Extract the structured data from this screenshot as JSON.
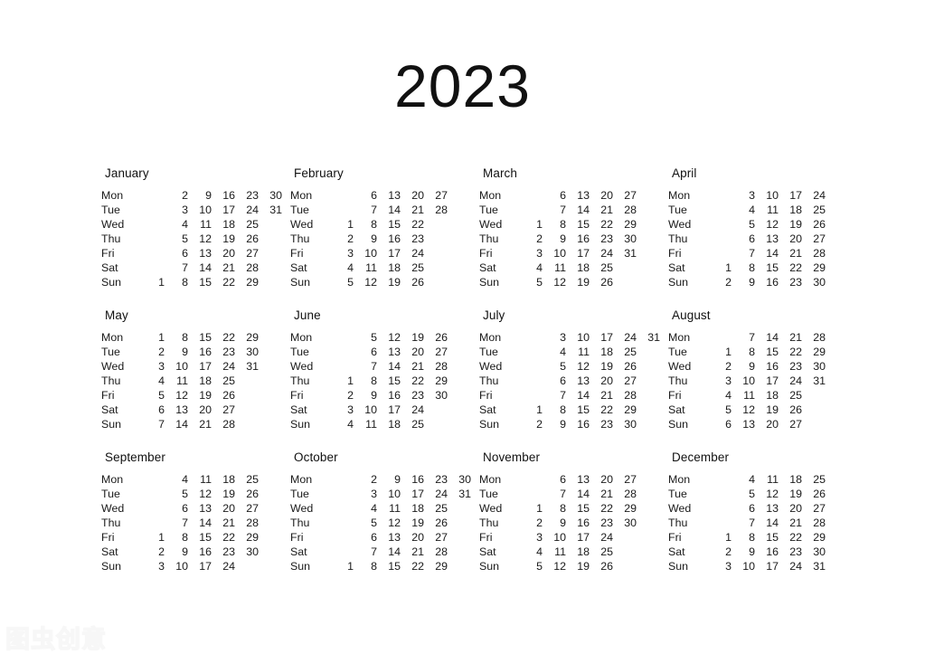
{
  "page": {
    "title": "2023",
    "background_color": "#ffffff",
    "text_color": "#1a1a1a"
  },
  "watermark": {
    "text": "图虫创意",
    "color": "#f7f7f7"
  },
  "weekday_labels": [
    "Mon",
    "Tue",
    "Wed",
    "Thu",
    "Fri",
    "Sat",
    "Sun"
  ],
  "calendar_data": {
    "year": 2023,
    "week_start": "Mon",
    "layout": {
      "columns": 4,
      "rows": 3
    },
    "months": [
      {
        "name": "January",
        "index": 1,
        "days_in_month": 31,
        "first_weekday": "Sun",
        "weeks": [
          [
            "",
            "2",
            "9",
            "16",
            "23",
            "30"
          ],
          [
            "",
            "3",
            "10",
            "17",
            "24",
            "31"
          ],
          [
            "",
            "4",
            "11",
            "18",
            "25",
            ""
          ],
          [
            "",
            "5",
            "12",
            "19",
            "26",
            ""
          ],
          [
            "",
            "6",
            "13",
            "20",
            "27",
            ""
          ],
          [
            "",
            "7",
            "14",
            "21",
            "28",
            ""
          ],
          [
            "1",
            "8",
            "15",
            "22",
            "29",
            ""
          ]
        ]
      },
      {
        "name": "February",
        "index": 2,
        "days_in_month": 28,
        "first_weekday": "Wed",
        "weeks": [
          [
            "",
            "6",
            "13",
            "20",
            "27",
            ""
          ],
          [
            "",
            "7",
            "14",
            "21",
            "28",
            ""
          ],
          [
            "1",
            "8",
            "15",
            "22",
            "",
            ""
          ],
          [
            "2",
            "9",
            "16",
            "23",
            "",
            ""
          ],
          [
            "3",
            "10",
            "17",
            "24",
            "",
            ""
          ],
          [
            "4",
            "11",
            "18",
            "25",
            "",
            ""
          ],
          [
            "5",
            "12",
            "19",
            "26",
            "",
            ""
          ]
        ]
      },
      {
        "name": "March",
        "index": 3,
        "days_in_month": 31,
        "first_weekday": "Wed",
        "weeks": [
          [
            "",
            "6",
            "13",
            "20",
            "27",
            ""
          ],
          [
            "",
            "7",
            "14",
            "21",
            "28",
            ""
          ],
          [
            "1",
            "8",
            "15",
            "22",
            "29",
            ""
          ],
          [
            "2",
            "9",
            "16",
            "23",
            "30",
            ""
          ],
          [
            "3",
            "10",
            "17",
            "24",
            "31",
            ""
          ],
          [
            "4",
            "11",
            "18",
            "25",
            "",
            ""
          ],
          [
            "5",
            "12",
            "19",
            "26",
            "",
            ""
          ]
        ]
      },
      {
        "name": "April",
        "index": 4,
        "days_in_month": 30,
        "first_weekday": "Sat",
        "weeks": [
          [
            "",
            "3",
            "10",
            "17",
            "24",
            ""
          ],
          [
            "",
            "4",
            "11",
            "18",
            "25",
            ""
          ],
          [
            "",
            "5",
            "12",
            "19",
            "26",
            ""
          ],
          [
            "",
            "6",
            "13",
            "20",
            "27",
            ""
          ],
          [
            "",
            "7",
            "14",
            "21",
            "28",
            ""
          ],
          [
            "1",
            "8",
            "15",
            "22",
            "29",
            ""
          ],
          [
            "2",
            "9",
            "16",
            "23",
            "30",
            ""
          ]
        ]
      },
      {
        "name": "May",
        "index": 5,
        "days_in_month": 31,
        "first_weekday": "Mon",
        "weeks": [
          [
            "1",
            "8",
            "15",
            "22",
            "29",
            ""
          ],
          [
            "2",
            "9",
            "16",
            "23",
            "30",
            ""
          ],
          [
            "3",
            "10",
            "17",
            "24",
            "31",
            ""
          ],
          [
            "4",
            "11",
            "18",
            "25",
            "",
            ""
          ],
          [
            "5",
            "12",
            "19",
            "26",
            "",
            ""
          ],
          [
            "6",
            "13",
            "20",
            "27",
            "",
            ""
          ],
          [
            "7",
            "14",
            "21",
            "28",
            "",
            ""
          ]
        ]
      },
      {
        "name": "June",
        "index": 6,
        "days_in_month": 30,
        "first_weekday": "Thu",
        "weeks": [
          [
            "",
            "5",
            "12",
            "19",
            "26",
            ""
          ],
          [
            "",
            "6",
            "13",
            "20",
            "27",
            ""
          ],
          [
            "",
            "7",
            "14",
            "21",
            "28",
            ""
          ],
          [
            "1",
            "8",
            "15",
            "22",
            "29",
            ""
          ],
          [
            "2",
            "9",
            "16",
            "23",
            "30",
            ""
          ],
          [
            "3",
            "10",
            "17",
            "24",
            "",
            ""
          ],
          [
            "4",
            "11",
            "18",
            "25",
            "",
            ""
          ]
        ]
      },
      {
        "name": "July",
        "index": 7,
        "days_in_month": 31,
        "first_weekday": "Sat",
        "weeks": [
          [
            "",
            "3",
            "10",
            "17",
            "24",
            "31"
          ],
          [
            "",
            "4",
            "11",
            "18",
            "25",
            ""
          ],
          [
            "",
            "5",
            "12",
            "19",
            "26",
            ""
          ],
          [
            "",
            "6",
            "13",
            "20",
            "27",
            ""
          ],
          [
            "",
            "7",
            "14",
            "21",
            "28",
            ""
          ],
          [
            "1",
            "8",
            "15",
            "22",
            "29",
            ""
          ],
          [
            "2",
            "9",
            "16",
            "23",
            "30",
            ""
          ]
        ]
      },
      {
        "name": "August",
        "index": 8,
        "days_in_month": 31,
        "first_weekday": "Tue",
        "weeks": [
          [
            "",
            "7",
            "14",
            "21",
            "28",
            ""
          ],
          [
            "1",
            "8",
            "15",
            "22",
            "29",
            ""
          ],
          [
            "2",
            "9",
            "16",
            "23",
            "30",
            ""
          ],
          [
            "3",
            "10",
            "17",
            "24",
            "31",
            ""
          ],
          [
            "4",
            "11",
            "18",
            "25",
            "",
            ""
          ],
          [
            "5",
            "12",
            "19",
            "26",
            "",
            ""
          ],
          [
            "6",
            "13",
            "20",
            "27",
            "",
            ""
          ]
        ]
      },
      {
        "name": "September",
        "index": 9,
        "days_in_month": 30,
        "first_weekday": "Fri",
        "weeks": [
          [
            "",
            "4",
            "11",
            "18",
            "25",
            ""
          ],
          [
            "",
            "5",
            "12",
            "19",
            "26",
            ""
          ],
          [
            "",
            "6",
            "13",
            "20",
            "27",
            ""
          ],
          [
            "",
            "7",
            "14",
            "21",
            "28",
            ""
          ],
          [
            "1",
            "8",
            "15",
            "22",
            "29",
            ""
          ],
          [
            "2",
            "9",
            "16",
            "23",
            "30",
            ""
          ],
          [
            "3",
            "10",
            "17",
            "24",
            "",
            ""
          ]
        ]
      },
      {
        "name": "October",
        "index": 10,
        "days_in_month": 31,
        "first_weekday": "Sun",
        "weeks": [
          [
            "",
            "2",
            "9",
            "16",
            "23",
            "30"
          ],
          [
            "",
            "3",
            "10",
            "17",
            "24",
            "31"
          ],
          [
            "",
            "4",
            "11",
            "18",
            "25",
            ""
          ],
          [
            "",
            "5",
            "12",
            "19",
            "26",
            ""
          ],
          [
            "",
            "6",
            "13",
            "20",
            "27",
            ""
          ],
          [
            "",
            "7",
            "14",
            "21",
            "28",
            ""
          ],
          [
            "1",
            "8",
            "15",
            "22",
            "29",
            ""
          ]
        ]
      },
      {
        "name": "November",
        "index": 11,
        "days_in_month": 30,
        "first_weekday": "Wed",
        "weeks": [
          [
            "",
            "6",
            "13",
            "20",
            "27",
            ""
          ],
          [
            "",
            "7",
            "14",
            "21",
            "28",
            ""
          ],
          [
            "1",
            "8",
            "15",
            "22",
            "29",
            ""
          ],
          [
            "2",
            "9",
            "16",
            "23",
            "30",
            ""
          ],
          [
            "3",
            "10",
            "17",
            "24",
            "",
            ""
          ],
          [
            "4",
            "11",
            "18",
            "25",
            "",
            ""
          ],
          [
            "5",
            "12",
            "19",
            "26",
            "",
            ""
          ]
        ]
      },
      {
        "name": "December",
        "index": 12,
        "days_in_month": 31,
        "first_weekday": "Fri",
        "weeks": [
          [
            "",
            "4",
            "11",
            "18",
            "25",
            ""
          ],
          [
            "",
            "5",
            "12",
            "19",
            "26",
            ""
          ],
          [
            "",
            "6",
            "13",
            "20",
            "27",
            ""
          ],
          [
            "",
            "7",
            "14",
            "21",
            "28",
            ""
          ],
          [
            "1",
            "8",
            "15",
            "22",
            "29",
            ""
          ],
          [
            "2",
            "9",
            "16",
            "23",
            "30",
            ""
          ],
          [
            "3",
            "10",
            "17",
            "24",
            "31",
            ""
          ]
        ]
      }
    ]
  }
}
